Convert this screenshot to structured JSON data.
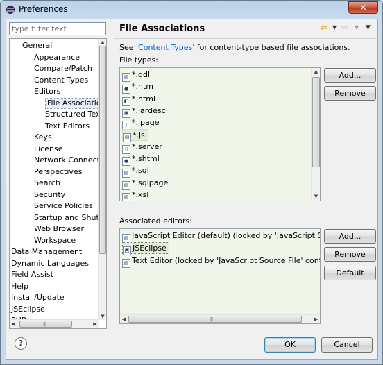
{
  "window": {
    "title": "Preferences",
    "close_label": "✕"
  },
  "sidebar": {
    "filter_placeholder": "type filter text",
    "items": [
      {
        "label": "General",
        "level": 1
      },
      {
        "label": "Appearance",
        "level": 2
      },
      {
        "label": "Compare/Patch",
        "level": 2
      },
      {
        "label": "Content Types",
        "level": 2
      },
      {
        "label": "Editors",
        "level": 2
      },
      {
        "label": "File Associatio",
        "level": 3,
        "selected": true
      },
      {
        "label": "Structured Text",
        "level": 3
      },
      {
        "label": "Text Editors",
        "level": 3
      },
      {
        "label": "Keys",
        "level": 2
      },
      {
        "label": "License",
        "level": 2
      },
      {
        "label": "Network Connectio",
        "level": 2
      },
      {
        "label": "Perspectives",
        "level": 2
      },
      {
        "label": "Search",
        "level": 2
      },
      {
        "label": "Security",
        "level": 2
      },
      {
        "label": "Service Policies",
        "level": 2
      },
      {
        "label": "Startup and Shutd",
        "level": 2
      },
      {
        "label": "Web Browser",
        "level": 2
      },
      {
        "label": "Workspace",
        "level": 2
      },
      {
        "label": "Data Management",
        "level": 0
      },
      {
        "label": "Dynamic Languages",
        "level": 0
      },
      {
        "label": "Field Assist",
        "level": 0
      },
      {
        "label": "Help",
        "level": 0
      },
      {
        "label": "Install/Update",
        "level": 0
      },
      {
        "label": "JSEclipse",
        "level": 0
      },
      {
        "label": "PHP",
        "level": 0
      }
    ]
  },
  "page": {
    "title": "File Associations",
    "description_prefix": "See ",
    "description_link": "'Content Types'",
    "description_suffix": " for content-type based file associations.",
    "file_types_label": "File types:",
    "editors_label": "Associated editors:"
  },
  "file_types": [
    {
      "label": "*.ddl",
      "icon": "sql-file-icon"
    },
    {
      "label": "*.htm",
      "icon": "web-file-icon"
    },
    {
      "label": "*.html",
      "icon": "html-file-icon"
    },
    {
      "label": "*.jardesc",
      "icon": "jar-file-icon"
    },
    {
      "label": "*.jpage",
      "icon": "java-page-icon"
    },
    {
      "label": "*.js",
      "icon": "js-file-icon",
      "selected": true
    },
    {
      "label": "*.server",
      "icon": "server-file-icon"
    },
    {
      "label": "*.shtml",
      "icon": "web-file-icon"
    },
    {
      "label": "*.sql",
      "icon": "sql-file-icon"
    },
    {
      "label": "*.sqlpage",
      "icon": "sql-file-icon"
    },
    {
      "label": "*.xsl",
      "icon": "xsl-file-icon"
    }
  ],
  "editors": [
    {
      "label": "JavaScript Editor (default) (locked by 'JavaScript Source",
      "icon": "js-editor-icon"
    },
    {
      "label": "JSEclipse",
      "icon": "jseclipse-icon",
      "selected": true
    },
    {
      "label": "Text Editor (locked by 'JavaScript Source File' content ty",
      "icon": "text-editor-icon"
    }
  ],
  "buttons": {
    "add_file_type": "Add...",
    "remove_file_type": "Remove",
    "add_editor": "Add...",
    "remove_editor": "Remove",
    "default_editor": "Default",
    "ok": "OK",
    "cancel": "Cancel",
    "help": "?"
  },
  "toolbar": {
    "back_icon": "back-arrow-icon",
    "forward_icon": "forward-arrow-icon",
    "menu_icon": "view-menu-icon"
  },
  "colors": {
    "list_background": "#f0f7ea",
    "link": "#0066cc",
    "title_bar": "#b9d1ea",
    "close_button": "#c74f3a"
  }
}
